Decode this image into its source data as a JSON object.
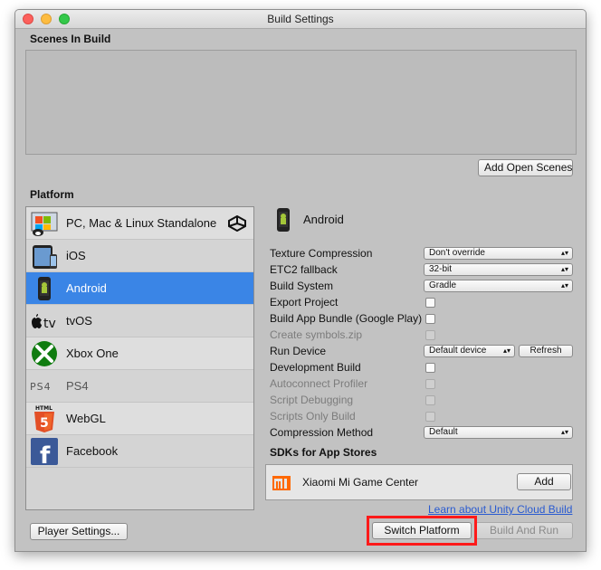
{
  "window": {
    "title": "Build Settings"
  },
  "scenes": {
    "label": "Scenes In Build",
    "add_open_scenes": "Add Open Scenes"
  },
  "platform": {
    "label": "Platform",
    "items": [
      {
        "label": "PC, Mac & Linux Standalone",
        "icon": "pc-mac-linux-icon"
      },
      {
        "label": "iOS",
        "icon": "ios-icon"
      },
      {
        "label": "Android",
        "icon": "android-icon",
        "selected": true
      },
      {
        "label": "tvOS",
        "icon": "tvos-icon"
      },
      {
        "label": "Xbox One",
        "icon": "xbox-icon"
      },
      {
        "label": "PS4",
        "icon": "ps4-icon"
      },
      {
        "label": "WebGL",
        "icon": "html5-icon"
      },
      {
        "label": "Facebook",
        "icon": "facebook-icon"
      }
    ]
  },
  "details": {
    "platform_name": "Android",
    "texture_compression": {
      "label": "Texture Compression",
      "value": "Don't override"
    },
    "etc2_fallback": {
      "label": "ETC2 fallback",
      "value": "32-bit"
    },
    "build_system": {
      "label": "Build System",
      "value": "Gradle"
    },
    "export_project": {
      "label": "Export Project"
    },
    "build_app_bundle": {
      "label": "Build App Bundle (Google Play)"
    },
    "create_symbols": {
      "label": "Create symbols.zip"
    },
    "run_device": {
      "label": "Run Device",
      "value": "Default device",
      "refresh": "Refresh"
    },
    "development_build": {
      "label": "Development Build"
    },
    "autoconnect_profiler": {
      "label": "Autoconnect Profiler"
    },
    "script_debugging": {
      "label": "Script Debugging"
    },
    "scripts_only_build": {
      "label": "Scripts Only Build"
    },
    "compression_method": {
      "label": "Compression Method",
      "value": "Default"
    },
    "sdks_label": "SDKs for App Stores",
    "sdk": {
      "name": "Xiaomi Mi Game Center",
      "add": "Add"
    },
    "cloud_build_link": "Learn about Unity Cloud Build"
  },
  "footer": {
    "player_settings": "Player Settings...",
    "switch_platform": "Switch Platform",
    "build_and_run": "Build And Run"
  },
  "colors": {
    "selection": "#3a85e6",
    "highlight": "#ff1a1a",
    "link": "#2a5bd0"
  }
}
